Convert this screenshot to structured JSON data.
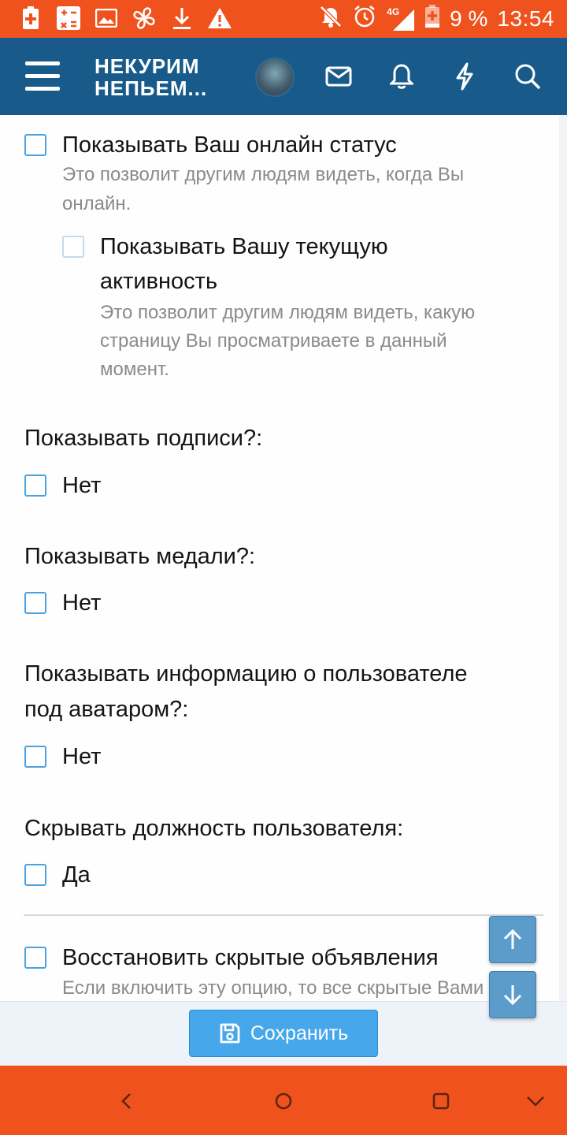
{
  "status_bar": {
    "battery_percent": "9 %",
    "time": "13:54",
    "network": "4G",
    "icons": [
      "battery-plus-icon",
      "calculator-icon",
      "image-icon",
      "fan-icon",
      "download-icon",
      "warning-icon",
      "bell-off-icon",
      "alarm-icon",
      "signal-icon",
      "battery-icon"
    ]
  },
  "header": {
    "logo_line1": "НЕКУРИМ",
    "logo_line2": "НЕПЬЕМ...",
    "icons": [
      "menu-icon",
      "avatar",
      "mail-icon",
      "bell-icon",
      "lightning-icon",
      "search-icon"
    ]
  },
  "options": {
    "online_status": {
      "label": "Показывать Ваш онлайн статус",
      "hint_line1": "Это позволит другим людям видеть, когда Вы",
      "hint_line2": "онлайн."
    },
    "activity": {
      "label_line1": "Показывать Вашу текущую",
      "label_line2": "активность",
      "hint_line1": "Это позволит другим людям видеть, какую",
      "hint_line2": "страницу Вы просматриваете в данный",
      "hint_line3": "момент."
    },
    "signatures": {
      "question": "Показывать подписи?:",
      "label": "Нет"
    },
    "medals": {
      "question": "Показывать медали?:",
      "label": "Нет"
    },
    "user_info": {
      "question_line1": "Показывать информацию о пользователе",
      "question_line2": "под аватаром?:",
      "label": "Нет"
    },
    "hide_title": {
      "question": "Скрывать должность пользователя:",
      "label": "Да"
    },
    "restore_notices": {
      "label": "Восстановить скрытые объявления",
      "hint": "Если включить эту опцию, то все скрытые Вами"
    }
  },
  "footer": {
    "save_label": "Сохранить"
  },
  "colors": {
    "status_bar": "#f0521e",
    "header": "#185a8a",
    "checkbox_border": "#4aa3df",
    "save_button": "#47a7eb"
  }
}
